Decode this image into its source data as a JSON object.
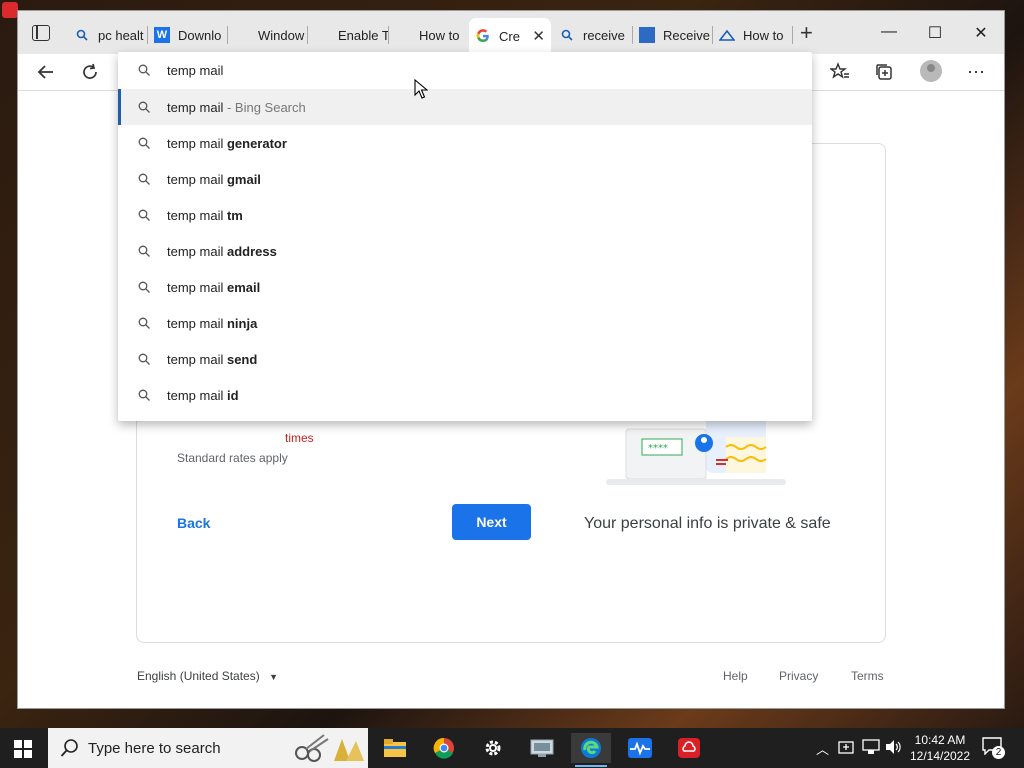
{
  "browser": {
    "tabs": [
      {
        "label": "pc healt",
        "icon": "search-icon"
      },
      {
        "label": "Downlo",
        "icon": "w-icon"
      },
      {
        "label": "Window",
        "icon": "microsoft-icon"
      },
      {
        "label": "Enable T",
        "icon": "microsoft-icon"
      },
      {
        "label": "How to",
        "icon": "microsoft-icon"
      },
      {
        "label": "Cre",
        "icon": "google-icon",
        "active": true
      },
      {
        "label": "receive",
        "icon": "search-icon"
      },
      {
        "label": "Receive",
        "icon": "receive-icon"
      },
      {
        "label": "How to",
        "icon": "cloud-icon"
      }
    ],
    "address_value": "temp mail",
    "suggestions": [
      {
        "prefix": "temp mail",
        "suffix": " - Bing Search",
        "bold": false
      },
      {
        "prefix": "temp mail ",
        "suffix": "generator",
        "bold": true
      },
      {
        "prefix": "temp mail ",
        "suffix": "gmail",
        "bold": true
      },
      {
        "prefix": "temp mail ",
        "suffix": "tm",
        "bold": true
      },
      {
        "prefix": "temp mail ",
        "suffix": "address",
        "bold": true
      },
      {
        "prefix": "temp mail ",
        "suffix": "email",
        "bold": true
      },
      {
        "prefix": "temp mail ",
        "suffix": "ninja",
        "bold": true
      },
      {
        "prefix": "temp mail ",
        "suffix": "send",
        "bold": true
      },
      {
        "prefix": "temp mail ",
        "suffix": "id",
        "bold": true
      }
    ]
  },
  "page": {
    "partial_red_text": "times",
    "rates_text": "Standard rates apply",
    "back_label": "Back",
    "next_label": "Next",
    "private_text": "Your personal info is private & safe",
    "language": "English (United States)",
    "footer_links": [
      "Help",
      "Privacy",
      "Terms"
    ]
  },
  "taskbar": {
    "search_placeholder": "Type here to search",
    "time": "10:42 AM",
    "date": "12/14/2022",
    "notification_count": "2"
  },
  "colors": {
    "accent": "#1a73e8",
    "highlight_bar": "#1a5fb4",
    "red_text": "#c5221f"
  }
}
